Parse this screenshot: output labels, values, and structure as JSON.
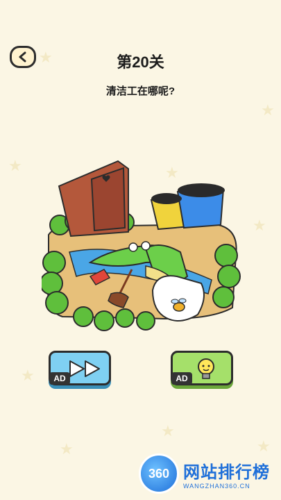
{
  "header": {
    "level_title": "第20关",
    "question": "清洁工在哪呢?"
  },
  "scene": {
    "description_icons": [
      "outhouse-icon",
      "trash-bins-icon",
      "crocodile-icon",
      "broom-icon",
      "bee-soap-icon"
    ]
  },
  "buttons": {
    "skip_badge": "AD",
    "hint_badge": "AD"
  },
  "watermark": {
    "logo_text": "360",
    "title": "网站排行榜",
    "subtitle": "WANGZHAN360.CN"
  },
  "colors": {
    "background": "#fbf6e4",
    "skip_button": "#7fd0f2",
    "hint_button": "#a5e06a"
  }
}
